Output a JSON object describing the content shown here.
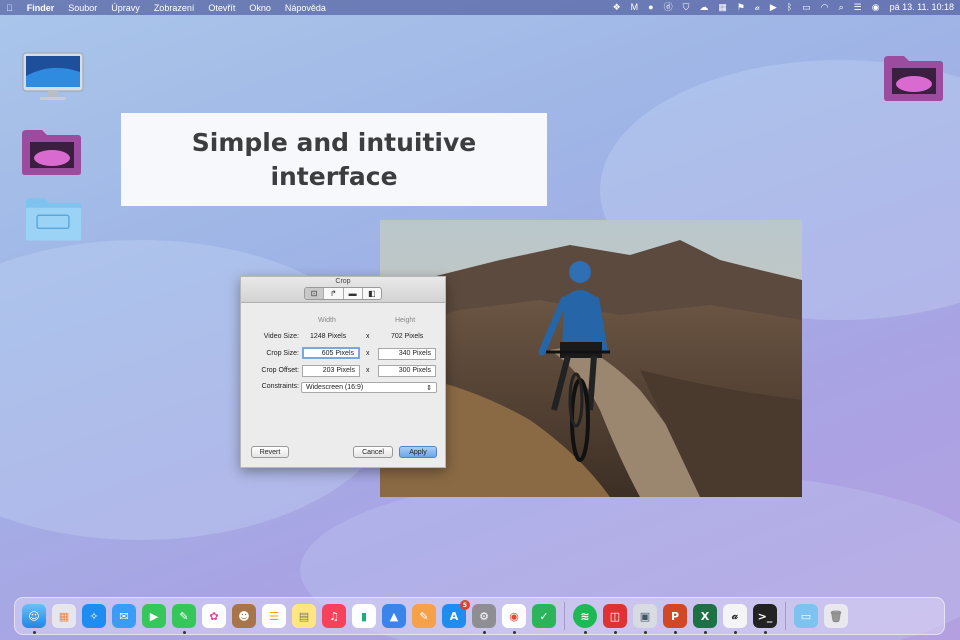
{
  "menubar": {
    "apple_icon": "apple-logo",
    "app_name": "Finder",
    "items": [
      "Soubor",
      "Úpravy",
      "Zobrazení",
      "Otevřít",
      "Okno",
      "Nápověda"
    ],
    "clock": "pá 13. 11.  10:18"
  },
  "card": {
    "title": "Simple and intuitive interface"
  },
  "crop_dialog": {
    "title": "Crop",
    "columns": {
      "width": "Width",
      "height": "Height"
    },
    "video_size": {
      "label": "Video Size:",
      "width": "1248 Pixels",
      "height": "702 Pixels"
    },
    "crop_size": {
      "label": "Crop Size:",
      "width": "605 Pixels",
      "height": "340 Pixels"
    },
    "crop_offset": {
      "label": "Crop Offset:",
      "width": "203 Pixels",
      "height": "300 Pixels"
    },
    "constraints": {
      "label": "Constraints:",
      "value": "Widescreen (16:9)"
    },
    "times": "x",
    "buttons": {
      "revert": "Revert",
      "cancel": "Cancel",
      "apply": "Apply"
    }
  },
  "dock": {
    "app_store_badge": "5"
  },
  "colors": {
    "accent_blue": "#6aa6ec",
    "card_text": "#3d3d40"
  }
}
